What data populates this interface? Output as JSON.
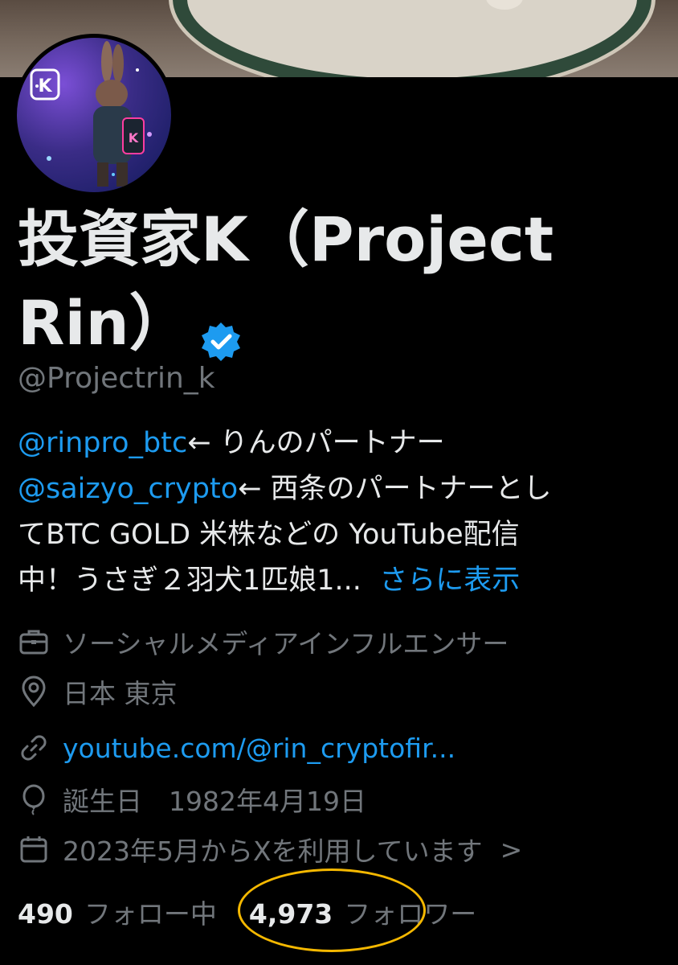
{
  "profile": {
    "display_name_line1": "投資家K（Project",
    "display_name_line2": "Rin）",
    "handle": "@Projectrin_k",
    "verified_color": "#1d9bf0"
  },
  "bio": {
    "mention1": "@rinpro_btc",
    "text1": "← りんのパートナー",
    "mention2": "@saizyo_crypto",
    "text2": "← 西条のパートナーとし",
    "line3": "てBTC GOLD 米株などの YouTube配信",
    "line4": "中！うさぎ２羽犬1匹娘1...",
    "show_more": "さらに表示"
  },
  "meta": {
    "category": "ソーシャルメディアインフルエンサー",
    "location": "日本 東京",
    "url": "youtube.com/@rin_cryptofir...",
    "birthday": "誕生日　1982年4月19日",
    "joined": "2023年5月からXを利用しています",
    "joined_chevron": ">"
  },
  "stats": {
    "following_count": "490",
    "following_label": "フォロー中",
    "followers_count": "4,973",
    "followers_label": "フォロワー"
  },
  "icons": [
    "briefcase-icon",
    "location-pin-icon",
    "link-icon",
    "balloon-icon",
    "calendar-icon",
    "verified-badge-icon",
    "chevron-right-icon"
  ],
  "colors": {
    "background": "#000000",
    "text": "#e7e9ea",
    "secondary_text": "#71767b",
    "link": "#1d9bf0",
    "highlight_ellipse": "#f5b800"
  },
  "avatar_badge_letter": "K"
}
